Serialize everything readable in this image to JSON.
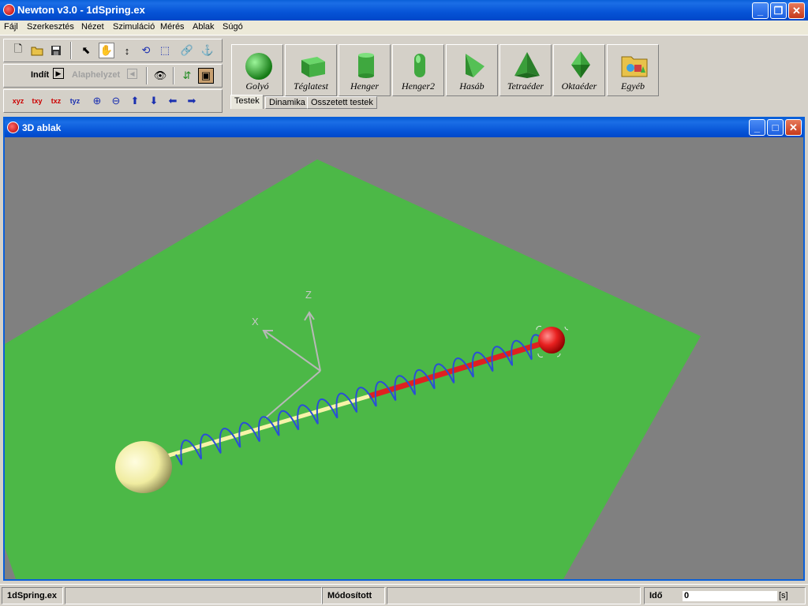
{
  "app": {
    "title": "Newton v3.0 - 1dSpring.ex"
  },
  "menu": [
    "Fájl",
    "Szerkesztés",
    "Nézet",
    "Szimuláció",
    "Mérés",
    "Ablak",
    "Súgó"
  ],
  "toolbar": {
    "start_label": "Indít",
    "reset_label": "Alaphelyzet"
  },
  "palette": {
    "shapes": [
      "Golyó",
      "Téglatest",
      "Henger",
      "Henger2",
      "Hasáb",
      "Tetraéder",
      "Oktaéder",
      "Egyéb"
    ],
    "tabs": [
      "Testek",
      "Dinamika",
      "Osszetett testek"
    ]
  },
  "window3d": {
    "title": "3D ablak",
    "axis_labels": {
      "z": "Z",
      "x": "X"
    }
  },
  "status": {
    "file": "1dSpring.ex",
    "state": "Módosított",
    "time_label": "Idő",
    "time_value": "0",
    "time_unit": "[s]"
  },
  "colors": {
    "floor": "#4cb847",
    "background": "#808080",
    "ball_left": "#f3f0b0",
    "ball_right": "#e8201f",
    "spring": "#2a4fd6",
    "title_blue": "#0a5fd8"
  }
}
